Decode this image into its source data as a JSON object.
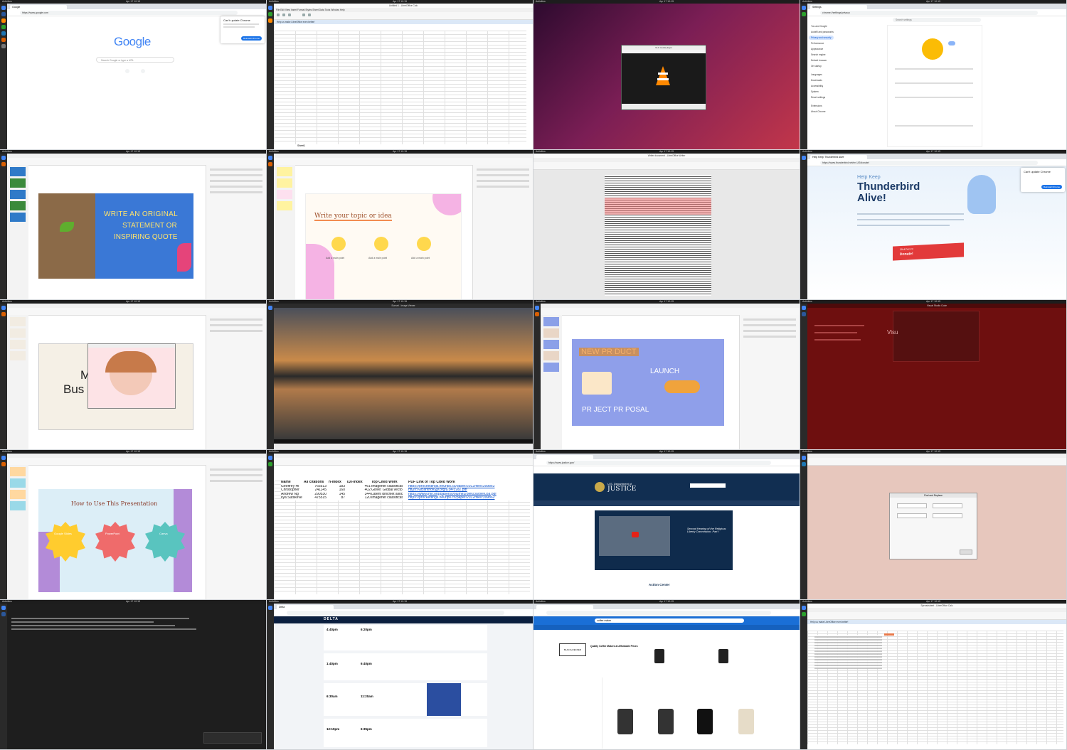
{
  "system": {
    "activities": "Activities",
    "clock": "Apr 17 10:15"
  },
  "t1": {
    "tab": "Google",
    "url": "https://www.google.com",
    "logo": "Google",
    "search_placeholder": "Search Google or type a URL",
    "popup_title": "Can't update Chrome",
    "popup_button": "Reinstall Chrome"
  },
  "t2": {
    "title": "Untitled 1 - LibreOffice Calc",
    "notice": "Help us make LibreOffice even better!",
    "menu": "File Edit View Insert Format Styles Sheet Data Tools Window Help",
    "sheet_tab": "Sheet1"
  },
  "t3": {
    "player_title": "VLC media player"
  },
  "t4": {
    "tab": "Settings",
    "url": "chrome://settings/privacy",
    "search_placeholder": "Search settings",
    "side_items": [
      "You and Google",
      "Autofill and passwords",
      "Privacy and security",
      "Performance",
      "Appearance",
      "Search engine",
      "Default browser",
      "On startup",
      "Languages",
      "Downloads",
      "Accessibility",
      "System",
      "Reset settings",
      "Extensions",
      "About Chrome"
    ]
  },
  "t5": {
    "slide_line1": "WRITE AN ORIGINAL",
    "slide_line2": "STATEMENT OR",
    "slide_line3": "INSPIRING QUOTE"
  },
  "t6": {
    "slide_heading": "Write your topic or idea",
    "point_labels": [
      "Add a main point",
      "Add a main point",
      "Add a main point"
    ]
  },
  "t7": {
    "title": "Writer document - LibreOffice Writer"
  },
  "t8": {
    "tab": "Help Keep Thunderbird Alive",
    "url": "https://www.thunderbird.net/en-US/donate/",
    "kicker": "Help Keep",
    "headline1": "Thunderbird",
    "headline2": "Alive!",
    "badge_line1": "Click here to",
    "badge_line2": "Donate!",
    "popup_title": "Can't update Chrome",
    "popup_button": "Reinstall Chrome"
  },
  "t9": {
    "slide_text1": "M",
    "slide_text2": "Bus"
  },
  "t10": {
    "title": "Sunset - Image Viewer"
  },
  "t11": {
    "slide_line1": "NEW PR  DUCT",
    "slide_line2": "LAUNCH",
    "slide_line3": "PR   JECT PR   POSAL"
  },
  "t12": {
    "title": "Visual Studio Code",
    "words": "Visu"
  },
  "t13": {
    "slide_heading": "How to Use This Presentation",
    "badges": [
      "Google Slides",
      "PowerPoint",
      "Canva"
    ]
  },
  "t14": {
    "headers": [
      "Name",
      "All citations",
      "h-index",
      "i10-index",
      "Top Cited Work",
      "PDF Link of Top Cited Work"
    ],
    "rows": [
      [
        "Geoffrey Hi",
        "765513",
        "183",
        "461",
        "Imagenet classificat",
        "https://proceedings.neurips.cc/paper/2012/file/c399862"
      ],
      [
        "Christopher",
        "241145",
        "160",
        "402",
        "Glove: Global vecto",
        "https://aclanthology.org/D14-1162.pdf"
      ],
      [
        "Andrew Ng",
        "290530",
        "145",
        "344",
        "Latent dirichlet alloc",
        "https://www.jmlr.org/papers/volume3/blei03a/blei03a.pdf"
      ],
      [
        "Ilya Sutskeve",
        "475515",
        "87",
        "120",
        "Imagenet classificat",
        "https://proceedings.neurips.cc/paper/2012/file/c399862"
      ]
    ]
  },
  "t15": {
    "url": "https://www.justice.gov/",
    "agency_line1": "U.S. Department of",
    "agency_line2": "JUSTICE",
    "action_center": "Action Center",
    "slide_caption": "Second Hearing of the Religious Liberty Commission, Part I"
  },
  "t17": {
    "dialog_title": "Find and Replace"
  },
  "t18": {
    "tab": "Delta",
    "brand": "DELTA",
    "times": [
      [
        "4:40pm",
        "6:20pm"
      ],
      [
        "1:40pm",
        "6:40pm"
      ],
      [
        "6:30am",
        "11:20am"
      ],
      [
        "12:19pm",
        "6:35pm"
      ]
    ]
  },
  "t19": {
    "search_value": "coffee maker",
    "section_title": "Quality Coffee Makers at Affordable Prices",
    "brand_box": "BLACK+DECKER"
  },
  "t20": {
    "title": "Spreadsheet - LibreOffice Calc",
    "notice": "Help us make LibreOffice even better!"
  },
  "colors": {
    "google_blue": "#4285f4",
    "google_red": "#ea4335",
    "google_yellow": "#fbbc05",
    "google_green": "#34a853",
    "ubuntu_purple": "#7b1e55",
    "thunderbird_blue": "#0a84ff",
    "doj_navy": "#112e51",
    "delta_navy": "#0b1f3f",
    "vscode_red": "#6e0f0f"
  }
}
